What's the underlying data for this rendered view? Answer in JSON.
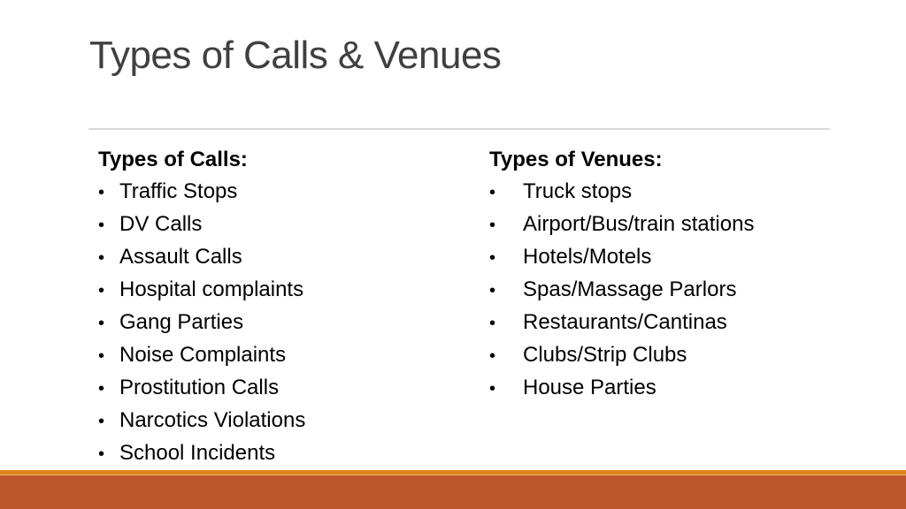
{
  "slide": {
    "title": "Types of Calls & Venues",
    "colors": {
      "title": "#404040",
      "divider": "#d9d9d9",
      "footer_accent": "#e0821e",
      "footer_bar": "#bc582c"
    },
    "left_column": {
      "heading": "Types of Calls:",
      "bullet_glyph": "•",
      "items": [
        "Traffic Stops",
        "DV Calls",
        "Assault Calls",
        "Hospital complaints",
        "Gang Parties",
        "Noise Complaints",
        "Prostitution Calls",
        "Narcotics Violations",
        "School Incidents"
      ]
    },
    "right_column": {
      "heading": "Types of Venues:",
      "bullet_glyph": "•",
      "items": [
        "Truck stops",
        "Airport/Bus/train stations",
        "Hotels/Motels",
        "Spas/Massage Parlors",
        "Restaurants/Cantinas",
        "Clubs/Strip Clubs",
        "House Parties"
      ]
    }
  }
}
